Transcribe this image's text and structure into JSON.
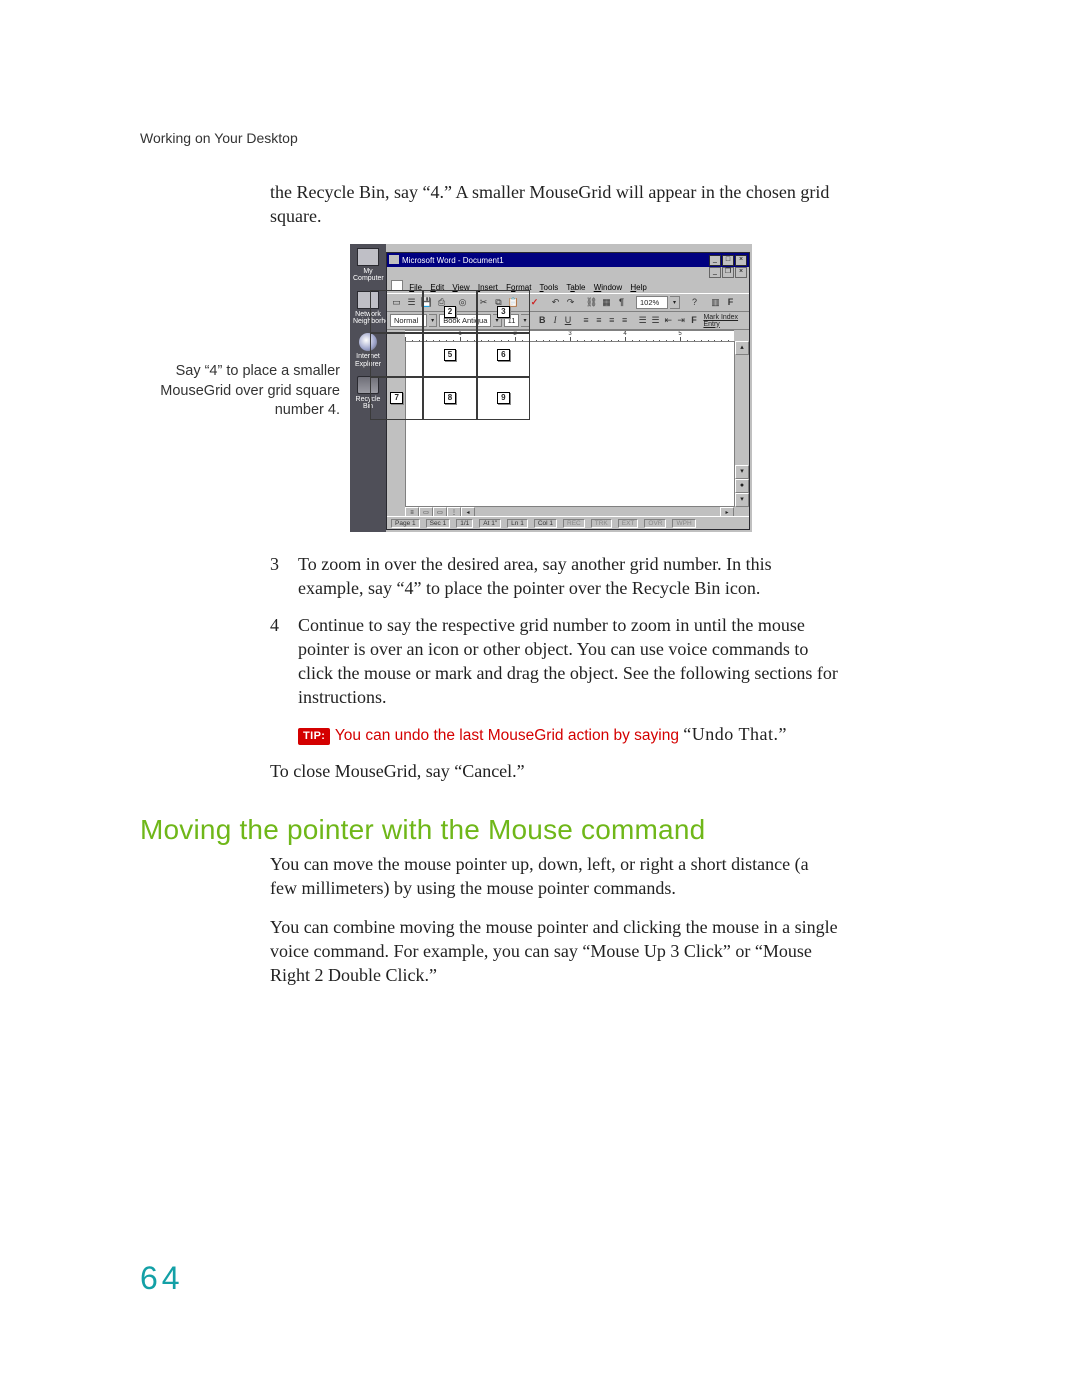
{
  "running_head": "Working on Your Desktop",
  "intro_paragraph": "the Recycle Bin, say “4.” A smaller MouseGrid will appear in the chosen grid square.",
  "side_caption": "Say “4” to place a smaller MouseGrid over grid square number 4.",
  "steps": {
    "3": "To zoom in over the desired area, say another grid number. In this example, say “4” to place the pointer over the Recycle Bin icon.",
    "4": "Continue to say the respective grid number to zoom in until the mouse pointer is over an icon or other object. You can use voice commands to click the mouse or mark and drag the object. See the following sections for instructions."
  },
  "tip": {
    "badge": "TIP:",
    "red_text": "You can undo the last MouseGrid action by saying ",
    "quoted": "“Undo That.”"
  },
  "close_line": "To close MouseGrid, say “Cancel.”",
  "section_heading": "Moving the pointer with the Mouse command",
  "p1": "You can move the mouse pointer up, down, left, or right a short distance (a few millimeters) by using the mouse pointer commands.",
  "p2": "You can combine moving the mouse pointer and clicking the mouse in a single voice command. For example, you can say “Mouse Up 3 Click” or “Mouse Right 2 Double Click.”",
  "page_number": "64",
  "screenshot": {
    "desktop_icons": {
      "my_computer": "My Computer",
      "network": "Network Neighborho",
      "ie": "Internet Explorer",
      "recycle": "Recycle Bin"
    },
    "titlebar": "Microsoft Word - Document1",
    "menubar": [
      "File",
      "Edit",
      "View",
      "Insert",
      "Format",
      "Tools",
      "Table",
      "Window",
      "Help"
    ],
    "fmt_style": "Normal",
    "fmt_font": "Book Antiqua",
    "fmt_size": "11",
    "zoom": "102%",
    "mark_entry": "Mark Index Entry",
    "status": {
      "page": "Page 1",
      "sec": "Sec 1",
      "pages": "1/1",
      "at": "At 1\"",
      "ln": "Ln 1",
      "col": "Col 1",
      "modes": [
        "REC",
        "TRK",
        "EXT",
        "OVR",
        "WPH"
      ]
    },
    "ruler_nums": [
      "1",
      "2",
      "3",
      "4",
      "5"
    ],
    "grid_nums": [
      "",
      "2",
      "3",
      "",
      "5",
      "6",
      "7",
      "8",
      "9"
    ]
  }
}
